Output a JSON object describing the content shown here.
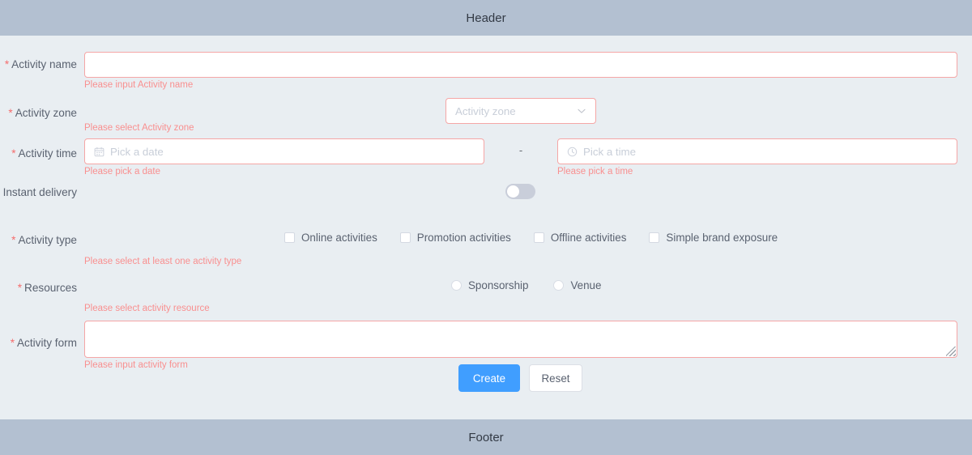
{
  "header": {
    "title": "Header"
  },
  "footer": {
    "title": "Footer"
  },
  "form": {
    "activity_name": {
      "label": "Activity name",
      "required": true,
      "value": "",
      "placeholder": "",
      "error": "Please input Activity name"
    },
    "activity_zone": {
      "label": "Activity zone",
      "required": true,
      "value": "",
      "placeholder": "Activity zone",
      "error": "Please select Activity zone",
      "icon": "chevron-down-icon"
    },
    "activity_time": {
      "label": "Activity time",
      "required": true,
      "separator": "-",
      "date": {
        "value": "",
        "placeholder": "Pick a date",
        "icon": "calendar-icon",
        "error": "Please pick a date"
      },
      "time": {
        "value": "",
        "placeholder": "Pick a time",
        "icon": "clock-icon",
        "error": "Please pick a time"
      }
    },
    "instant_delivery": {
      "label": "Instant delivery",
      "required": false,
      "checked": false
    },
    "activity_type": {
      "label": "Activity type",
      "required": true,
      "error": "Please select at least one activity type",
      "options": [
        {
          "label": "Online activities",
          "checked": false
        },
        {
          "label": "Promotion activities",
          "checked": false
        },
        {
          "label": "Offline activities",
          "checked": false
        },
        {
          "label": "Simple brand exposure",
          "checked": false
        }
      ]
    },
    "resources": {
      "label": "Resources",
      "required": true,
      "error": "Please select activity resource",
      "options": [
        {
          "label": "Sponsorship",
          "selected": false
        },
        {
          "label": "Venue",
          "selected": false
        }
      ]
    },
    "activity_form": {
      "label": "Activity form",
      "required": true,
      "value": "",
      "placeholder": "",
      "error": "Please input activity form"
    },
    "actions": {
      "create_label": "Create",
      "reset_label": "Reset"
    }
  },
  "colors": {
    "bar_background": "#b3c0d1",
    "page_background": "#e9eef2",
    "error_border": "#f5a6a6",
    "error_text": "#f98f8f",
    "required_star": "#f56c6c",
    "primary_button": "#409eff"
  }
}
